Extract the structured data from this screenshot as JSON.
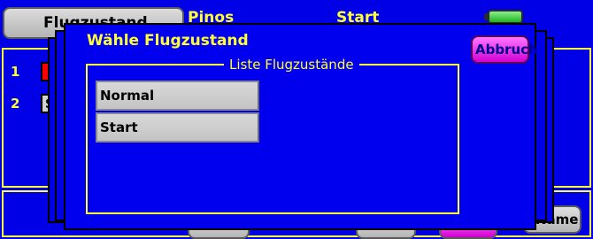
{
  "background": {
    "flight_mode_button": "Flugzustand",
    "top_labels": [
      "Pinos",
      "Start"
    ],
    "rows": [
      {
        "number": "1",
        "mark": ""
      },
      {
        "number": "2",
        "mark": "S"
      }
    ],
    "name_button": "Name",
    "battery_icon": "battery-icon"
  },
  "dialog": {
    "title": "Wähle Flugzustand",
    "cancel_button": "Abbruch",
    "group_legend": "Liste Flugzustände",
    "items": [
      {
        "label": "Normal"
      },
      {
        "label": "Start"
      }
    ]
  },
  "colors": {
    "screen_background": "#0000e6",
    "text_yellow": "#ffff33",
    "cancel_button": "#d200d2",
    "list_item": "#c8c8c8",
    "battery": "#1eb41e"
  }
}
